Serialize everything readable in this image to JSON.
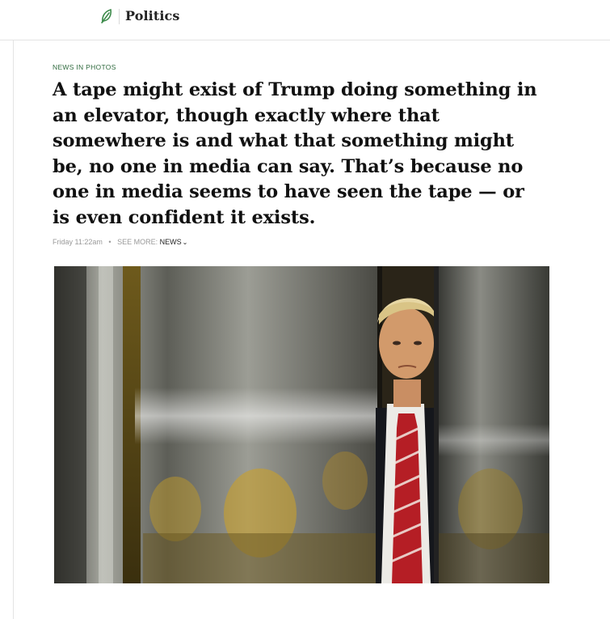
{
  "header": {
    "section_name": "Politics",
    "logo_icon": "leaf-icon",
    "accent_color": "#3c8a4a"
  },
  "article": {
    "kicker": "NEWS IN PHOTOS",
    "headline": "A tape might exist of Trump doing something in an elevator, though exactly where that somewhere is and what that something might be, no one in media can say. That’s because no one in media seems to have seen the tape — or is even confident it exists.",
    "timestamp": "Friday 11:22am",
    "separator": "•",
    "see_more_label": "SEE MORE:",
    "see_more_link": "NEWS",
    "see_more_icon": "chevron-down-icon"
  },
  "photo": {
    "subject": "man in suit and red striped tie standing in an open mirrored elevator"
  }
}
